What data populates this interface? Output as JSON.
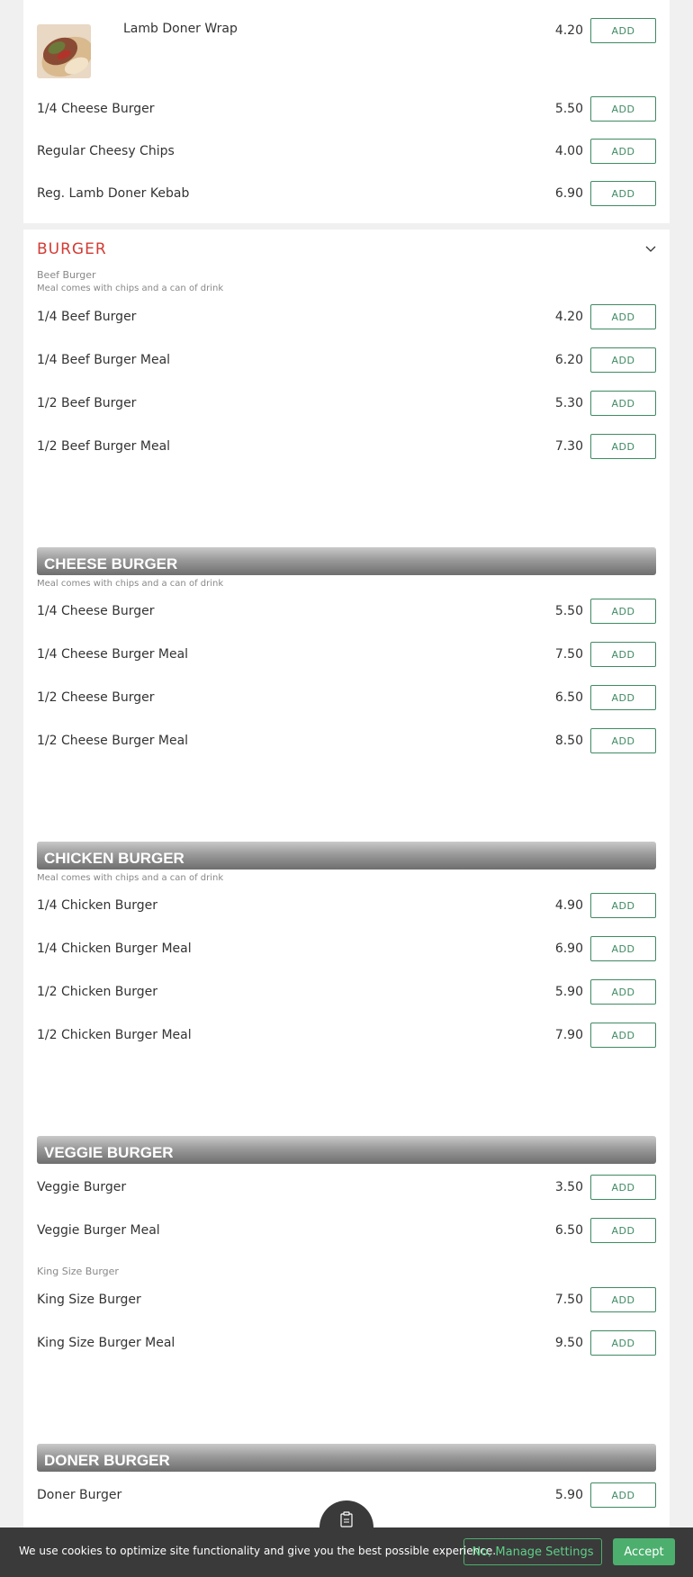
{
  "top_section": {
    "featured_item": {
      "name": "Lamb Doner Wrap",
      "price": "4.20",
      "add": "ADD"
    },
    "items": [
      {
        "name": "1/4 Cheese Burger",
        "price": "5.50",
        "add": "ADD"
      },
      {
        "name": "Regular Cheesy Chips",
        "price": "4.00",
        "add": "ADD"
      },
      {
        "name": "Reg. Lamb Doner Kebab",
        "price": "6.90",
        "add": "ADD"
      }
    ]
  },
  "burger_section": {
    "title": "BURGER",
    "icon": "chevron-down-icon",
    "beef": {
      "subtitle": "Beef Burger",
      "note": "Meal comes with chips and a can of drink",
      "items": [
        {
          "name": "1/4 Beef Burger",
          "price": "4.20",
          "add": "ADD"
        },
        {
          "name": "1/4 Beef Burger Meal",
          "price": "6.20",
          "add": "ADD"
        },
        {
          "name": "1/2 Beef Burger",
          "price": "5.30",
          "add": "ADD"
        },
        {
          "name": "1/2 Beef Burger Meal",
          "price": "7.30",
          "add": "ADD"
        }
      ]
    },
    "cheese": {
      "banner": "CHEESE BURGER",
      "note": "Meal comes with chips and a can of drink",
      "items": [
        {
          "name": "1/4 Cheese Burger",
          "price": "5.50",
          "add": "ADD"
        },
        {
          "name": "1/4 Cheese Burger Meal",
          "price": "7.50",
          "add": "ADD"
        },
        {
          "name": "1/2 Cheese Burger",
          "price": "6.50",
          "add": "ADD"
        },
        {
          "name": "1/2 Cheese Burger Meal",
          "price": "8.50",
          "add": "ADD"
        }
      ]
    },
    "chicken": {
      "banner": "CHICKEN BURGER",
      "note": "Meal comes with chips and a can of drink",
      "items": [
        {
          "name": "1/4 Chicken Burger",
          "price": "4.90",
          "add": "ADD"
        },
        {
          "name": "1/4 Chicken Burger Meal",
          "price": "6.90",
          "add": "ADD"
        },
        {
          "name": "1/2 Chicken Burger",
          "price": "5.90",
          "add": "ADD"
        },
        {
          "name": "1/2 Chicken Burger Meal",
          "price": "7.90",
          "add": "ADD"
        }
      ]
    },
    "veggie": {
      "banner": "VEGGIE BURGER",
      "items": [
        {
          "name": "Veggie Burger",
          "price": "3.50",
          "add": "ADD"
        },
        {
          "name": "Veggie Burger Meal",
          "price": "6.50",
          "add": "ADD"
        }
      ],
      "king_subtitle": "King Size Burger",
      "king_items": [
        {
          "name": "King Size Burger",
          "price": "7.50",
          "add": "ADD"
        },
        {
          "name": "King Size Burger Meal",
          "price": "9.50",
          "add": "ADD"
        }
      ]
    },
    "doner": {
      "banner": "DONER BURGER",
      "items": [
        {
          "name": "Doner Burger",
          "price": "5.90",
          "add": "ADD"
        }
      ]
    }
  },
  "floating_button": {
    "icon": "order-icon"
  },
  "cookie_bar": {
    "text": "We use cookies to optimize site functionality and give you the best possible experience.",
    "manage_label": "No, Manage Settings",
    "accept_label": "Accept"
  },
  "colors": {
    "accent_red": "#d33b34",
    "add_green": "#3f8a63",
    "accept_green": "#4caf6e",
    "dark_bar": "#3a3a3a"
  }
}
